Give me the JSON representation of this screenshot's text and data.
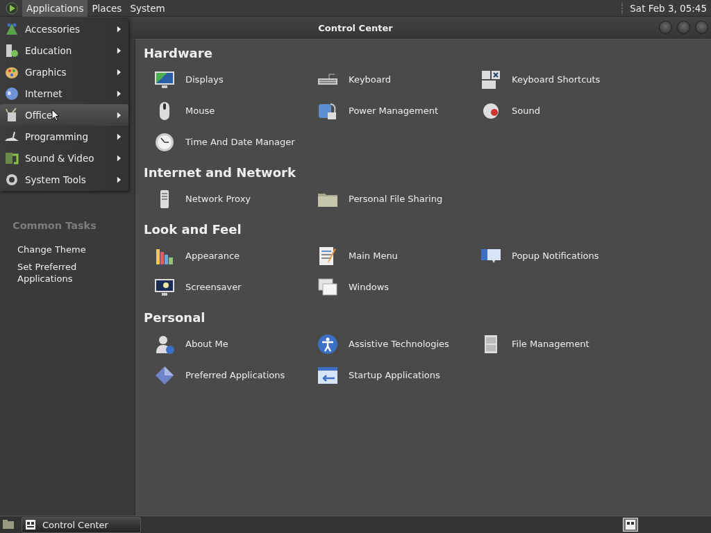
{
  "top_panel": {
    "menus": [
      {
        "label": "Applications",
        "selected": true
      },
      {
        "label": "Places",
        "selected": false
      },
      {
        "label": "System",
        "selected": false
      }
    ],
    "clock": "Sat Feb  3, 05:45"
  },
  "app_menu": {
    "items": [
      {
        "label": "Accessories",
        "selected": false
      },
      {
        "label": "Education",
        "selected": false
      },
      {
        "label": "Graphics",
        "selected": false
      },
      {
        "label": "Internet",
        "selected": false
      },
      {
        "label": "Office",
        "selected": true
      },
      {
        "label": "Programming",
        "selected": false
      },
      {
        "label": "Sound & Video",
        "selected": false
      },
      {
        "label": "System Tools",
        "selected": false
      }
    ]
  },
  "window": {
    "title": "Control Center"
  },
  "sidebar": {
    "common_tasks": {
      "title": "Common Tasks",
      "items": [
        "Change Theme",
        "Set Preferred Applications"
      ]
    }
  },
  "sections": [
    {
      "title": "Hardware",
      "items": [
        {
          "label": "Displays"
        },
        {
          "label": "Keyboard"
        },
        {
          "label": "Keyboard Shortcuts"
        },
        {
          "label": "Mouse"
        },
        {
          "label": "Power Management"
        },
        {
          "label": "Sound"
        },
        {
          "label": "Time And Date Manager"
        }
      ]
    },
    {
      "title": "Internet and Network",
      "items": [
        {
          "label": "Network Proxy"
        },
        {
          "label": "Personal File Sharing"
        }
      ]
    },
    {
      "title": "Look and Feel",
      "items": [
        {
          "label": "Appearance"
        },
        {
          "label": "Main Menu"
        },
        {
          "label": "Popup Notifications"
        },
        {
          "label": "Screensaver"
        },
        {
          "label": "Windows"
        }
      ]
    },
    {
      "title": "Personal",
      "items": [
        {
          "label": "About Me"
        },
        {
          "label": "Assistive Technologies"
        },
        {
          "label": "File Management"
        },
        {
          "label": "Preferred Applications"
        },
        {
          "label": "Startup Applications"
        }
      ]
    }
  ],
  "taskbar": {
    "tasks": [
      {
        "label": "Control Center"
      }
    ]
  }
}
